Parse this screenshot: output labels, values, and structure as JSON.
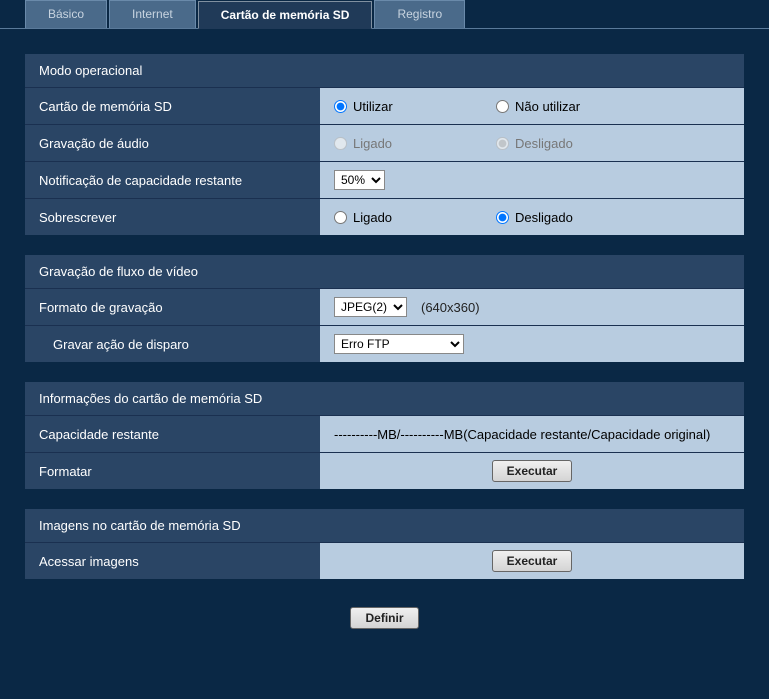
{
  "tabs": {
    "basic": "Básico",
    "internet": "Internet",
    "sd": "Cartão de memória SD",
    "log": "Registro"
  },
  "sections": {
    "operational_mode": {
      "title": "Modo operacional",
      "sd_card": {
        "label": "Cartão de memória SD",
        "opt_use": "Utilizar",
        "opt_not_use": "Não utilizar"
      },
      "audio": {
        "label": "Gravação de áudio",
        "opt_on": "Ligado",
        "opt_off": "Desligado"
      },
      "capacity_notify": {
        "label": "Notificação de capacidade restante",
        "value": "50%",
        "options": [
          "50%"
        ]
      },
      "overwrite": {
        "label": "Sobrescrever",
        "opt_on": "Ligado",
        "opt_off": "Desligado"
      }
    },
    "video_stream": {
      "title": "Gravação de fluxo de vídeo",
      "format": {
        "label": "Formato de gravação",
        "value": "JPEG(2)",
        "options": [
          "JPEG(2)"
        ],
        "hint": "(640x360)"
      },
      "trigger": {
        "label": "Gravar ação de disparo",
        "value": "Erro FTP",
        "options": [
          "Erro FTP"
        ]
      }
    },
    "sd_info": {
      "title": "Informações do cartão de memória SD",
      "capacity": {
        "label": "Capacidade restante",
        "value": "----------MB/----------MB(Capacidade restante/Capacidade original)"
      },
      "format": {
        "label": "Formatar",
        "button": "Executar"
      }
    },
    "sd_images": {
      "title": "Imagens no cartão de memória SD",
      "access": {
        "label": "Acessar imagens",
        "button": "Executar"
      }
    }
  },
  "footer": {
    "define": "Definir"
  }
}
